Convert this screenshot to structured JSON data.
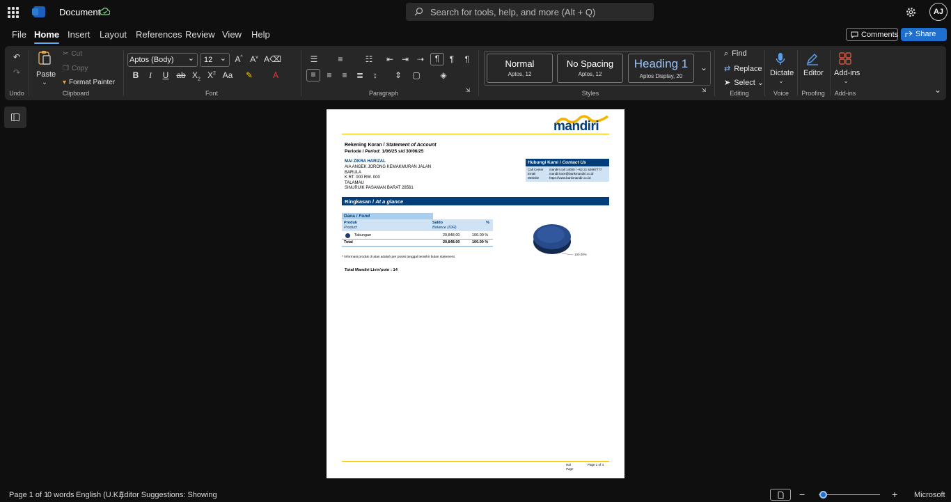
{
  "app": {
    "title": "Document",
    "search_placeholder": "Search for tools, help, and more (Alt + Q)",
    "avatar_initials": "AJ"
  },
  "menu": {
    "items": [
      "File",
      "Home",
      "Insert",
      "Layout",
      "References",
      "Review",
      "View",
      "Help"
    ],
    "active": "Home",
    "comments_label": "Comments",
    "share_label": "Share"
  },
  "ribbon": {
    "undo_label": "Undo",
    "clipboard": {
      "paste": "Paste",
      "cut": "Cut",
      "copy": "Copy",
      "format_painter": "Format Painter",
      "label": "Clipboard"
    },
    "font": {
      "family": "Aptos (Body)",
      "size": "12",
      "label": "Font"
    },
    "paragraph_label": "Paragraph",
    "styles": {
      "items": [
        {
          "name": "Normal",
          "sub": "Aptos, 12"
        },
        {
          "name": "No Spacing",
          "sub": "Aptos, 12"
        },
        {
          "name": "Heading 1",
          "sub": "Aptos Display, 20"
        }
      ],
      "label": "Styles"
    },
    "editing": {
      "find": "Find",
      "replace": "Replace",
      "select": "Select",
      "label": "Editing"
    },
    "voice": {
      "dictate": "Dictate",
      "label": "Voice"
    },
    "proofing": {
      "editor": "Editor",
      "label": "Proofing"
    },
    "addins": {
      "addins": "Add-ins",
      "label": "Add-ins"
    }
  },
  "document": {
    "brand": "mandiri",
    "title_id": "Rekening Koran / ",
    "title_en": "Statement of Account",
    "period_label_id": "Periode / ",
    "period_label_en": "Period",
    "period_value": ":  1/06/25 s/d 30/06/25",
    "customer": {
      "name": "MAI ZIKRA HARIZAL",
      "address": [
        "AIA ANGEK JORONG KEMAKMURAN JALAN",
        "BARULA",
        "K RT. 000 RW. 000",
        "TALAMAU",
        "SINURUIK PASAMAN BARAT 28561"
      ]
    },
    "contact": {
      "heading_id": "Hubungi Kami / ",
      "heading_en": "Contact Us",
      "rows": [
        {
          "label": "Call Center",
          "value": "mandiri call 14000 / +62 21 52997777"
        },
        {
          "label": "Email",
          "value": "mandiricare@bankmandiri.co.id"
        },
        {
          "label": "Website",
          "value": "https://www.bankmandiri.co.id"
        }
      ]
    },
    "summary_id": "Ringkasan / ",
    "summary_en": "At a glance",
    "fund_id": "Dana / ",
    "fund_en": "Fund",
    "table": {
      "col_product_id": "Produk",
      "col_product_en": "Product",
      "col_balance_id": "Saldo",
      "col_balance_en": "Balance  (IDR)",
      "col_pct": "%",
      "rows": [
        {
          "product": "Tabungan",
          "balance": "20,848.00",
          "pct": "100.00 %"
        }
      ],
      "total_label": "Total",
      "total_balance": "20,848.00",
      "total_pct": "100.00 %"
    },
    "chart_label": "100.00%",
    "note": "* Informasi produk di atas adalah per posisi tanggal terakhir bulan statement.",
    "points": "Total Mandiri Livin'poin : 14",
    "footer_page_id": "Hal",
    "footer_page_en": "Page",
    "footer_page_value": "Page 1 of 4"
  },
  "status": {
    "page": "Page 1 of 1",
    "words": "0 words",
    "language": "English (U.K.)",
    "editor": "Editor Suggestions: Showing",
    "feedback": "Microsoft"
  },
  "colors": {
    "accent": "#1f6fcf",
    "mandiri_blue": "#003d79",
    "mandiri_gold": "#f4b400"
  }
}
